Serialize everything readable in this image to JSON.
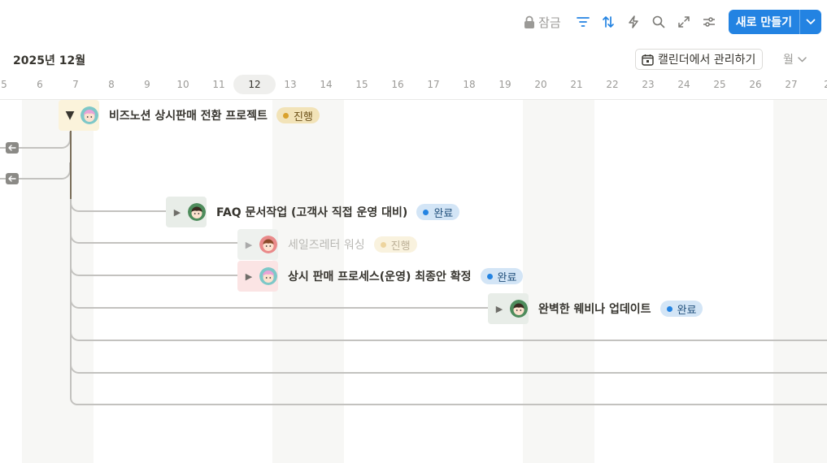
{
  "toolbar": {
    "lock_label": "잠금",
    "new_label": "새로 만들기",
    "icons": [
      "lock-icon",
      "filter-icon",
      "sort-icon",
      "automation-icon",
      "search-icon",
      "expand-icon",
      "settings-icon",
      "chevron-down-icon"
    ]
  },
  "header": {
    "month": "2025년 12월",
    "calendar_button": "캘린더에서 관리하기",
    "scale": "월"
  },
  "days": [
    "5",
    "6",
    "7",
    "8",
    "9",
    "10",
    "11",
    "12",
    "13",
    "14",
    "15",
    "16",
    "17",
    "18",
    "19",
    "20",
    "21",
    "22",
    "23",
    "24",
    "25",
    "26",
    "27",
    "2"
  ],
  "today": "12",
  "colors": {
    "accent": "#2383e2",
    "status_in_progress_bg": "#f2e3b8",
    "status_in_progress_dot": "#d9a12b",
    "status_done_bg": "#d3e5f6",
    "status_done_dot": "#2383e2"
  },
  "tasks": [
    {
      "name": "비즈노션 상시판매 전환 프로젝트",
      "status": "진행",
      "expanded": true
    },
    {
      "name": "FAQ 문서작업 (고객사 직접 운영 대비)",
      "status": "완료"
    },
    {
      "name": "세일즈레터 워싱",
      "status": "진행"
    },
    {
      "name": "상시 판매 프로세스(운영) 최종안 확정",
      "status": "완료"
    },
    {
      "name": "완벽한 웨비나 업데이트",
      "status": "완료"
    }
  ]
}
